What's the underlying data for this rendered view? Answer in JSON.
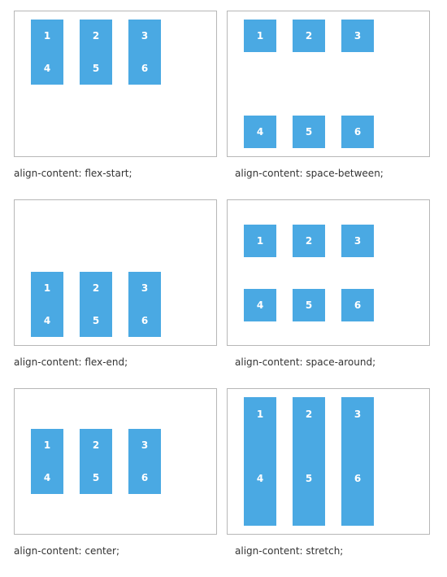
{
  "item_color": "#4aa9e3",
  "panels": [
    {
      "mode": "flex-start",
      "caption": "align-content: flex-start;",
      "items": [
        "1",
        "2",
        "3",
        "4",
        "5",
        "6"
      ]
    },
    {
      "mode": "space-between",
      "caption": "align-content: space-between;",
      "items": [
        "1",
        "2",
        "3",
        "4",
        "5",
        "6"
      ]
    },
    {
      "mode": "flex-end",
      "caption": "align-content: flex-end;",
      "items": [
        "1",
        "2",
        "3",
        "4",
        "5",
        "6"
      ]
    },
    {
      "mode": "space-around",
      "caption": "align-content: space-around;",
      "items": [
        "1",
        "2",
        "3",
        "4",
        "5",
        "6"
      ]
    },
    {
      "mode": "center",
      "caption": "align-content: center;",
      "items": [
        "1",
        "2",
        "3",
        "4",
        "5",
        "6"
      ]
    },
    {
      "mode": "stretch",
      "caption": "align-content: stretch;",
      "items": [
        "1",
        "2",
        "3",
        "4",
        "5",
        "6"
      ]
    }
  ]
}
